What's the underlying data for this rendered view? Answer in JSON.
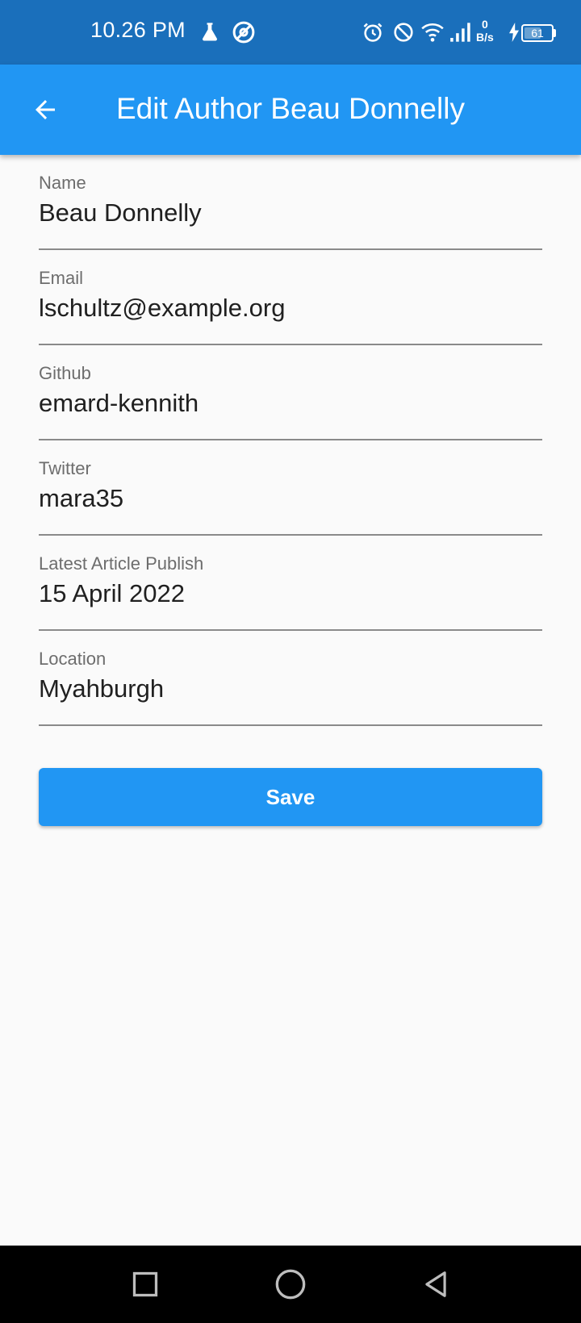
{
  "status_bar": {
    "time": "10.26 PM",
    "net_speed_value": "0",
    "net_speed_unit": "B/s",
    "battery_level": "61",
    "battery_fraction": 0.61,
    "icons": [
      "flask-icon",
      "at-sign-icon",
      "alarm-icon",
      "do-not-disturb-icon",
      "wifi-icon",
      "signal-icon",
      "charging-icon",
      "battery-icon"
    ]
  },
  "app_bar": {
    "back_icon": "arrow-left-icon",
    "title": "Edit Author Beau Donnelly"
  },
  "form": {
    "fields": [
      {
        "label": "Name",
        "value": "Beau Donnelly"
      },
      {
        "label": "Email",
        "value": "lschultz@example.org"
      },
      {
        "label": "Github",
        "value": "emard-kennith"
      },
      {
        "label": "Twitter",
        "value": "mara35"
      },
      {
        "label": "Latest Article Publish",
        "value": "15 April 2022"
      },
      {
        "label": "Location",
        "value": "Myahburgh"
      }
    ],
    "save_label": "Save"
  },
  "nav_bar": {
    "icons": [
      "recents-square-icon",
      "home-circle-icon",
      "back-triangle-icon"
    ]
  },
  "colors": {
    "status_bar": "#1a6fbb",
    "primary": "#2196f3",
    "background": "#fafafa",
    "nav_bar": "#000000"
  }
}
